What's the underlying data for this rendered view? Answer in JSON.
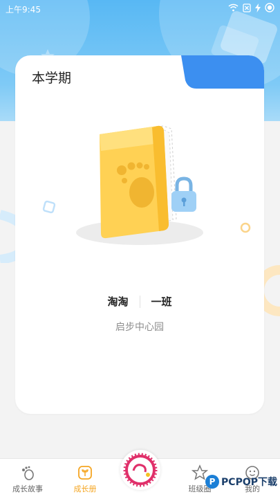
{
  "status_bar": {
    "time": "上午9:45"
  },
  "card": {
    "title": "本学期"
  },
  "student": {
    "name": "淘淘",
    "class": "一班"
  },
  "school": {
    "name": "启步中心园"
  },
  "tabbar": {
    "items": [
      {
        "label": "成长故事"
      },
      {
        "label": "成长册"
      },
      {
        "label": "班级圈"
      },
      {
        "label": "我的"
      }
    ]
  },
  "watermark": {
    "text": "PCPOP下载"
  },
  "colors": {
    "accent": "#f5a623",
    "header_blue": "#58b8f4",
    "tab_blue": "#3c8ff0"
  }
}
